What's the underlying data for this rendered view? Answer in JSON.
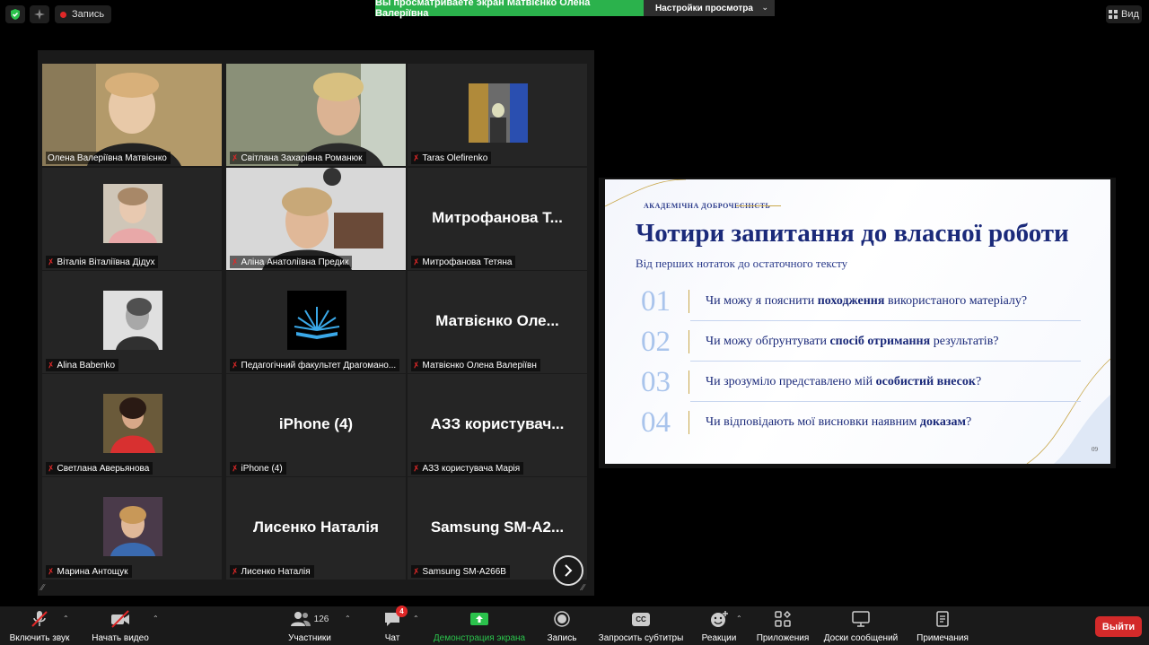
{
  "topbar": {
    "record_label": "Запись",
    "share_banner": "Вы просматриваете экран Матвієнко Олена Валеріївна",
    "view_options": "Настройки просмотра",
    "view_button": "Вид"
  },
  "gallery": {
    "tiles": [
      {
        "name": "Олена Валеріївна Матвієнко",
        "type": "video",
        "active": true
      },
      {
        "name": "Світлана Захарівна Романюк",
        "type": "video"
      },
      {
        "name": "Taras Olefirenko",
        "type": "avatar"
      },
      {
        "name": "Віталія Віталіївна Дідух",
        "type": "avatar"
      },
      {
        "name": "Аліна Анатоліївна Предик",
        "type": "video"
      },
      {
        "name": "Митрофанова Тетяна",
        "type": "name",
        "bigname": "Митрофанова Т..."
      },
      {
        "name": "Alina Babenko",
        "type": "avatar"
      },
      {
        "name": "Педагогічний факультет Драгомано...",
        "type": "avatar"
      },
      {
        "name": "Матвієнко Олена Валеріївн",
        "type": "name",
        "bigname": "Матвієнко Оле..."
      },
      {
        "name": "Светлана Аверьянова",
        "type": "avatar"
      },
      {
        "name": "iPhone (4)",
        "type": "name",
        "bigname": "iPhone (4)"
      },
      {
        "name": "АЗЗ користувача Марія",
        "type": "name",
        "bigname": "АЗЗ користувач..."
      },
      {
        "name": "Марина Антощук",
        "type": "avatar"
      },
      {
        "name": "Лисенко Наталія",
        "type": "name",
        "bigname": "Лисенко Наталія"
      },
      {
        "name": "Samsung SM-A266B",
        "type": "name",
        "bigname": "Samsung SM-A2..."
      }
    ]
  },
  "slide": {
    "badge": "АКАДЕМІЧНА ДОБРОЧЕСНІСТЬ",
    "title": "Чотири запитання до власної роботи",
    "subtitle": "Від перших нотаток до остаточного тексту",
    "questions": [
      {
        "num": "01",
        "pre": "Чи можу я пояснити ",
        "bold": "походження",
        "post": " використаного матеріалу?"
      },
      {
        "num": "02",
        "pre": "Чи можу обґрунтувати ",
        "bold": "спосіб отримання",
        "post": " результатів?"
      },
      {
        "num": "03",
        "pre": "Чи зрозуміло представлено мій ",
        "bold": "особистий внесок",
        "post": "?"
      },
      {
        "num": "04",
        "pre": "Чи відповідають мої висновки наявним ",
        "bold": "доказам",
        "post": "?"
      }
    ],
    "page": "09"
  },
  "toolbar": {
    "mic": "Включить звук",
    "video": "Начать видео",
    "participants": "Участники",
    "participants_count": "126",
    "chat": "Чат",
    "chat_badge": "4",
    "share": "Демонстрация экрана",
    "record": "Запись",
    "captions": "Запросить субтитры",
    "captions_icon": "CC",
    "reactions": "Реакции",
    "apps": "Приложения",
    "whiteboards": "Доски сообщений",
    "notes": "Примечания",
    "leave": "Выйти"
  },
  "colors": {
    "active_speaker": "#e7e72b",
    "share_green": "#2bb24c",
    "leave_red": "#d32a2a",
    "slide_title": "#1b2a7a"
  }
}
